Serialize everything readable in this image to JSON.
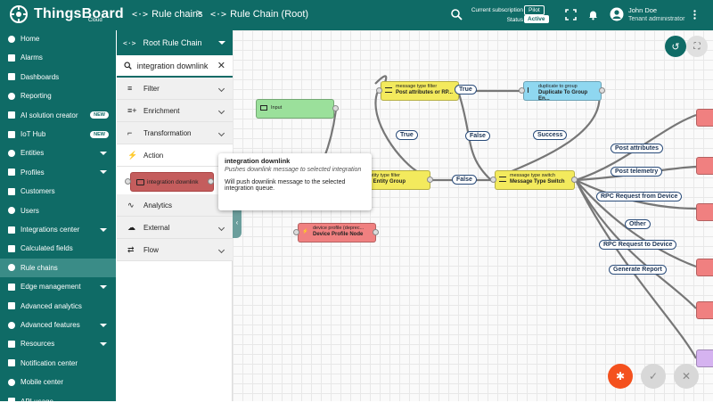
{
  "app": {
    "name": "ThingsBoard",
    "sub": "Cloud"
  },
  "header": {
    "crumbs": [
      {
        "icon": "<·>",
        "label": "Rule chains"
      },
      {
        "icon": "<·>",
        "label": "Rule Chain (Root)"
      }
    ],
    "sep": ">",
    "sub_label": "Current subscription",
    "status_label": "Status",
    "plan": "Pilot",
    "status": "Active",
    "user_name": "John Doe",
    "user_role": "Tenant administrator"
  },
  "sidebar": {
    "items": [
      {
        "label": "Home",
        "name": "home"
      },
      {
        "label": "Alarms",
        "name": "alarms"
      },
      {
        "label": "Dashboards",
        "name": "dashboards"
      },
      {
        "label": "Reporting",
        "name": "reporting"
      },
      {
        "label": "AI solution creator",
        "name": "ai-solution-creator",
        "badge": "NEW"
      },
      {
        "label": "IoT Hub",
        "name": "iot-hub",
        "badge": "NEW"
      },
      {
        "label": "Entities",
        "name": "entities",
        "expand": true
      },
      {
        "label": "Profiles",
        "name": "profiles",
        "expand": true
      },
      {
        "label": "Customers",
        "name": "customers"
      },
      {
        "label": "Users",
        "name": "users"
      },
      {
        "label": "Integrations center",
        "name": "integrations-center",
        "expand": true
      },
      {
        "label": "Calculated fields",
        "name": "calculated-fields"
      },
      {
        "label": "Rule chains",
        "name": "rule-chains",
        "active": true
      },
      {
        "label": "Edge management",
        "name": "edge-management",
        "expand": true
      },
      {
        "label": "Advanced analytics",
        "name": "advanced-analytics"
      },
      {
        "label": "Advanced features",
        "name": "advanced-features",
        "expand": true
      },
      {
        "label": "Resources",
        "name": "resources",
        "expand": true
      },
      {
        "label": "Notification center",
        "name": "notification-center"
      },
      {
        "label": "Mobile center",
        "name": "mobile-center"
      },
      {
        "label": "API usage",
        "name": "api-usage"
      }
    ]
  },
  "panel": {
    "chain_name": "Root Rule Chain",
    "search_value": "integration downlink",
    "categories": [
      {
        "label": "Filter",
        "icon": "≡"
      },
      {
        "label": "Enrichment",
        "icon": "≡+"
      },
      {
        "label": "Transformation",
        "icon": "⌐"
      },
      {
        "label": "Action",
        "icon": "⚡",
        "open": true
      },
      {
        "label": "Analytics",
        "icon": "∿"
      },
      {
        "label": "External",
        "icon": "☁"
      },
      {
        "label": "Flow",
        "icon": "⇄"
      }
    ],
    "action_node": "integration downlink"
  },
  "tooltip": {
    "title": "integration downlink",
    "desc": "Pushes downlink message to selected integration",
    "text": "Will push downlink message to the selected integration queue."
  },
  "canvas": {
    "nodes": {
      "input": {
        "title": "Input"
      },
      "mtf": {
        "type": "message type filter",
        "name": "Post attributes or RP..."
      },
      "dup": {
        "type": "duplicate to group",
        "name": "Duplicate To Group En..."
      },
      "etf": {
        "type": "entity type filter",
        "name": "Is Entity Group"
      },
      "mts": {
        "type": "message type switch",
        "name": "Message Type Switch"
      },
      "dp": {
        "type": "device profile (deprec...",
        "name": "Device Profile Node"
      }
    },
    "links": [
      "True",
      "False",
      "True",
      "Success",
      "False",
      "Post attributes",
      "Post telemetry",
      "RPC Request from Device",
      "Other",
      "RPC Request to Device",
      "Generate Report"
    ]
  },
  "colors": {
    "primary": "#0f6b66",
    "filter": "#f3ea5d",
    "enrich": "#8fd7f0",
    "input": "#9be09b",
    "action": "#f08080",
    "fab": "#f4511e"
  }
}
